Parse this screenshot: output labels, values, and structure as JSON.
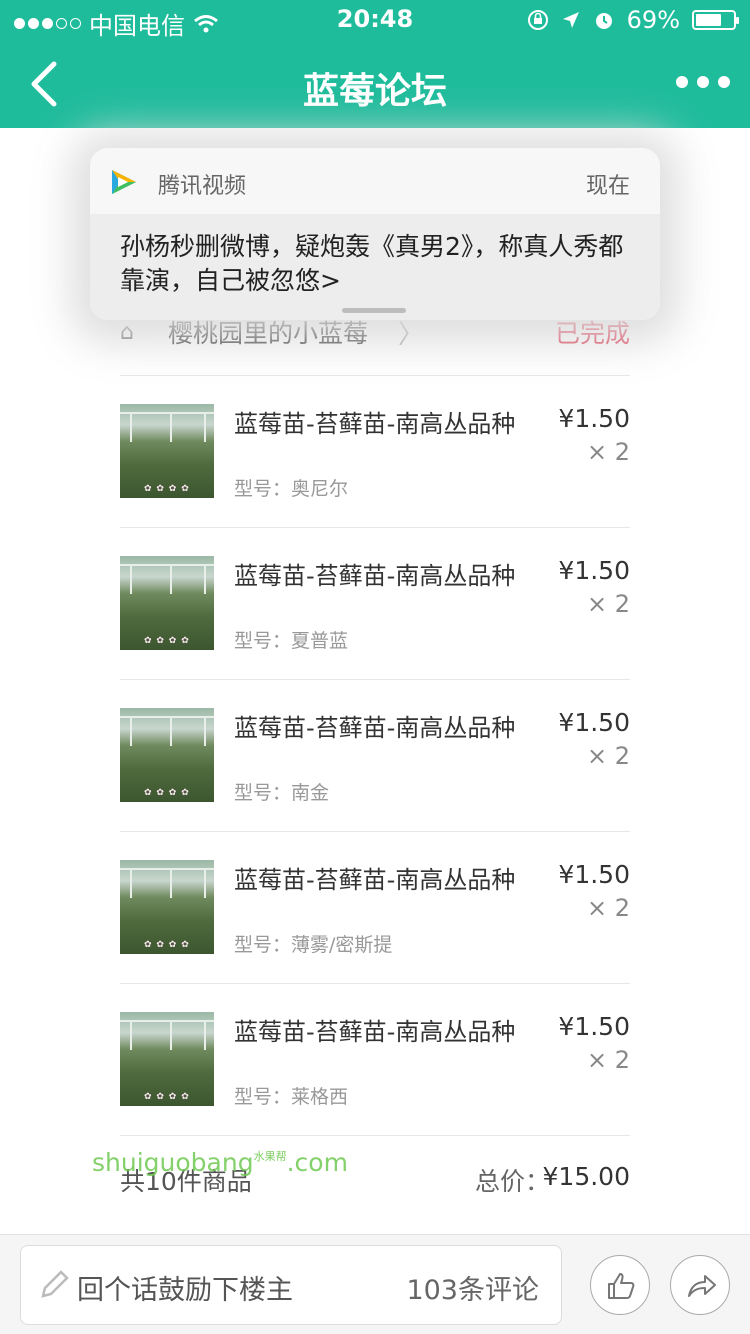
{
  "status_bar": {
    "carrier": "中国电信",
    "time": "20:48",
    "battery": "69%",
    "battery_level": 0.69
  },
  "header": {
    "title": "蓝莓论坛",
    "back_icon": "chevron-left-icon",
    "more_icon": "more-dots-icon"
  },
  "notification": {
    "app_name": "腾讯视频",
    "time": "现在",
    "message": "孙杨秒删微博，疑炮轰《真男2》，称真人秀都靠演，自己被忽悠>"
  },
  "order": {
    "store_name": "樱桃园里的小蓝莓",
    "status": "已完成",
    "items": [
      {
        "name": "蓝莓苗-苔藓苗-南高丛品种",
        "spec": "型号：奥尼尔",
        "price": "¥1.50",
        "qty": "× 2"
      },
      {
        "name": "蓝莓苗-苔藓苗-南高丛品种",
        "spec": "型号：夏普蓝",
        "price": "¥1.50",
        "qty": "× 2"
      },
      {
        "name": "蓝莓苗-苔藓苗-南高丛品种",
        "spec": "型号：南金",
        "price": "¥1.50",
        "qty": "× 2"
      },
      {
        "name": "蓝莓苗-苔藓苗-南高丛品种",
        "spec": "型号：薄雾/密斯提",
        "price": "¥1.50",
        "qty": "× 2"
      },
      {
        "name": "蓝莓苗-苔藓苗-南高丛品种",
        "spec": "型号：莱格西",
        "price": "¥1.50",
        "qty": "× 2"
      }
    ],
    "count_text": "共10件商品",
    "total_label": "总价：",
    "total": "¥15.00"
  },
  "watermark": {
    "text": "shuiguobang",
    "suffix": ".com",
    "small": "水果帮"
  },
  "bottom_bar": {
    "placeholder": "回个话鼓励下楼主",
    "comments": "103条评论",
    "like_icon": "thumbs-up-icon",
    "share_icon": "share-arrow-icon"
  },
  "colors": {
    "brand": "#1fbc9c",
    "status_done": "#e0314b"
  }
}
